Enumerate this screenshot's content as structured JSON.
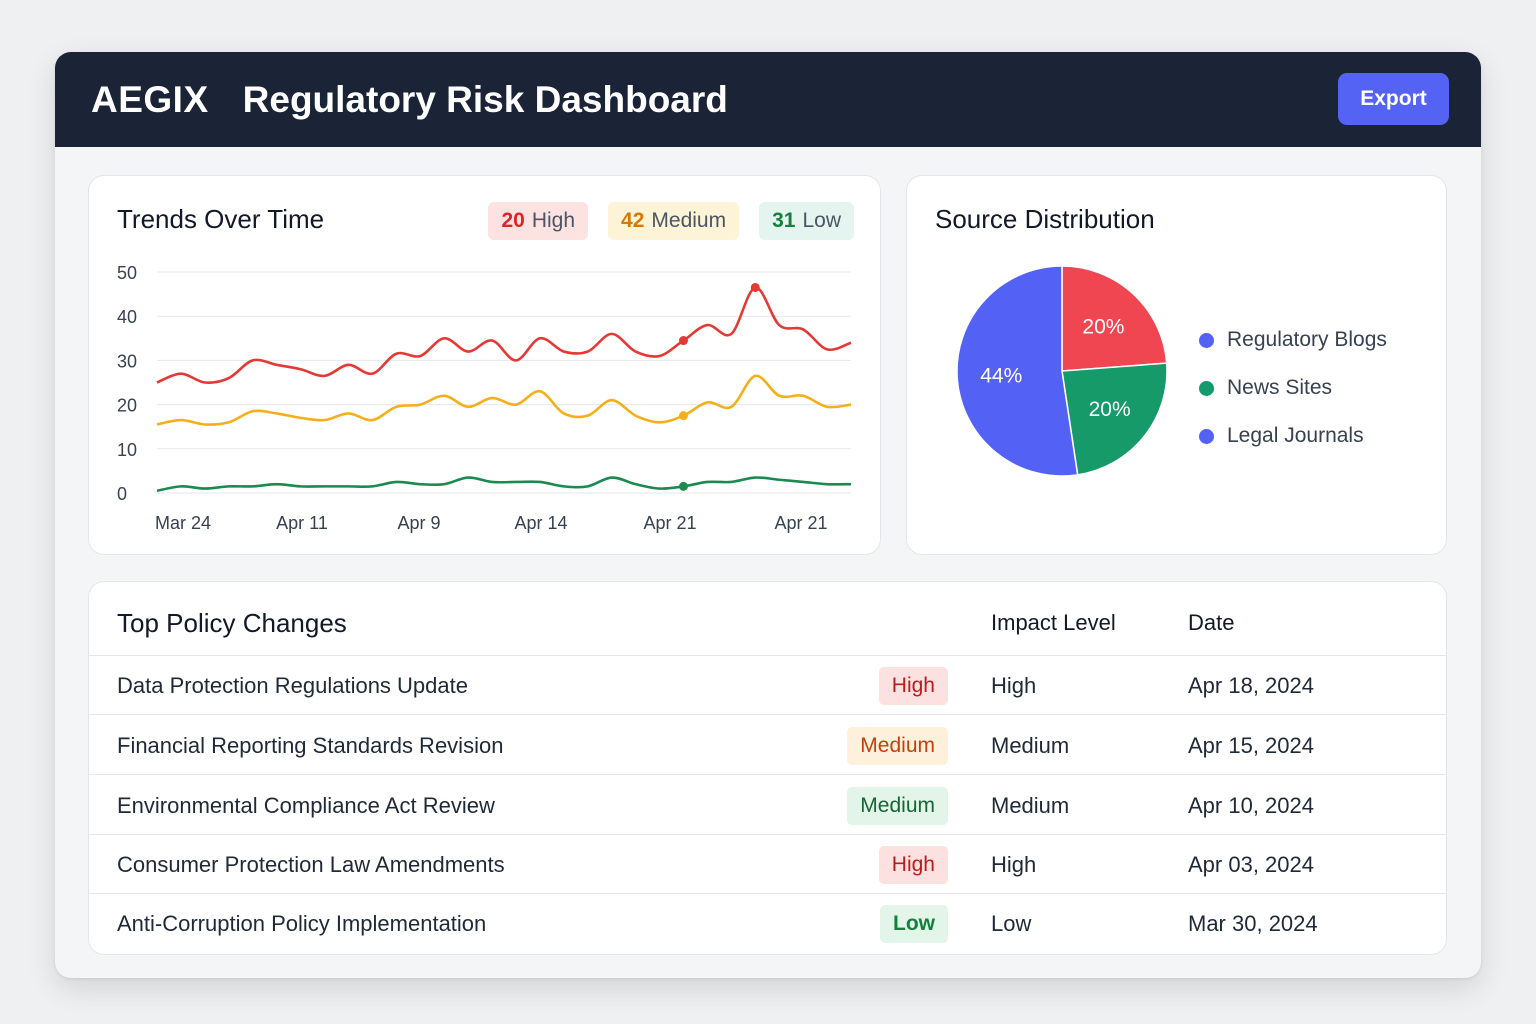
{
  "header": {
    "brand": "AEGIX",
    "title": "Regulatory Risk Dashboard",
    "export_label": "Export",
    "background": "#1a2436",
    "accent": "#5563f5"
  },
  "trends": {
    "title": "Trends Over Time",
    "badges": [
      {
        "count": "20",
        "label": "High",
        "color": "#dc2626"
      },
      {
        "count": "42",
        "label": "Medium",
        "color": "#d97706"
      },
      {
        "count": "31",
        "label": "Low",
        "color": "#15803d"
      }
    ]
  },
  "source": {
    "title": "Source Distribution"
  },
  "chart_data": [
    {
      "type": "line",
      "title": "Trends Over Time",
      "x_tick_labels": [
        "Mar 24",
        "Apr 11",
        "Apr 9",
        "Apr 14",
        "Apr 21",
        "Apr 21"
      ],
      "y_ticks": [
        0,
        10,
        20,
        30,
        40,
        50
      ],
      "ylim": [
        0,
        50
      ],
      "grid": true,
      "series": [
        {
          "name": "High",
          "color": "#e53935",
          "values": [
            25,
            27,
            25,
            26,
            30,
            29,
            28,
            26.5,
            29,
            27,
            31.5,
            31,
            35,
            32,
            34.5,
            30,
            35,
            32,
            32,
            36,
            32,
            31,
            34.5,
            38,
            36,
            46.5,
            38,
            37,
            32.5,
            34
          ],
          "markers": [
            22,
            25
          ]
        },
        {
          "name": "Medium",
          "color": "#f5b019",
          "values": [
            15.5,
            16.5,
            15.5,
            16,
            18.5,
            18,
            17,
            16.5,
            18,
            16.5,
            19.5,
            20,
            22,
            19.5,
            21.5,
            20,
            23,
            18,
            17.5,
            21,
            17.5,
            16,
            17.5,
            20.5,
            19.5,
            26.5,
            22,
            22,
            19.5,
            20
          ],
          "markers": [
            22
          ]
        },
        {
          "name": "Low",
          "color": "#1a8a4e",
          "values": [
            0.5,
            1.5,
            1,
            1.5,
            1.5,
            2,
            1.5,
            1.5,
            1.5,
            1.5,
            2.5,
            2,
            2,
            3.5,
            2.5,
            2.5,
            2.5,
            1.5,
            1.5,
            3.5,
            2,
            1,
            1.5,
            2.5,
            2.5,
            3.5,
            3,
            2.5,
            2,
            2
          ],
          "markers": [
            22
          ]
        }
      ]
    },
    {
      "type": "pie",
      "title": "Source Distribution",
      "slices": [
        {
          "label": "Regulatory Blogs",
          "value": 20,
          "display": "20%",
          "color": "#ef4651"
        },
        {
          "label": "News Sites",
          "value": 20,
          "display": "20%",
          "color": "#169a6a"
        },
        {
          "label": "Legal Journals",
          "value": 44,
          "display": "44%",
          "color": "#5461f5"
        }
      ],
      "legend": [
        {
          "label": "Regulatory Blogs",
          "color": "#5461f5"
        },
        {
          "label": "News Sites",
          "color": "#169a6a"
        },
        {
          "label": "Legal Journals",
          "color": "#5461f5"
        }
      ],
      "legend_position": "right"
    }
  ],
  "policy_table": {
    "title": "Top Policy Changes",
    "columns": [
      "Impact Level",
      "Date"
    ],
    "rows": [
      {
        "name": "Data Protection Regulations Update",
        "badge": "High",
        "badge_style": "high",
        "level": "High",
        "date": "Apr 18, 2024"
      },
      {
        "name": "Financial Reporting Standards Revision",
        "badge": "Medium",
        "badge_style": "medium",
        "level": "Medium",
        "date": "Apr 15, 2024"
      },
      {
        "name": "Environmental Compliance Act Review",
        "badge": "Medium",
        "badge_style": "medium-green",
        "level": "Medium",
        "date": "Apr 10, 2024"
      },
      {
        "name": "Consumer Protection Law Amendments",
        "badge": "High",
        "badge_style": "high",
        "level": "High",
        "date": "Apr 03, 2024"
      },
      {
        "name": "Anti-Corruption Policy Implementation",
        "badge": "Low",
        "badge_style": "low",
        "level": "Low",
        "date": "Mar 30, 2024"
      }
    ]
  }
}
